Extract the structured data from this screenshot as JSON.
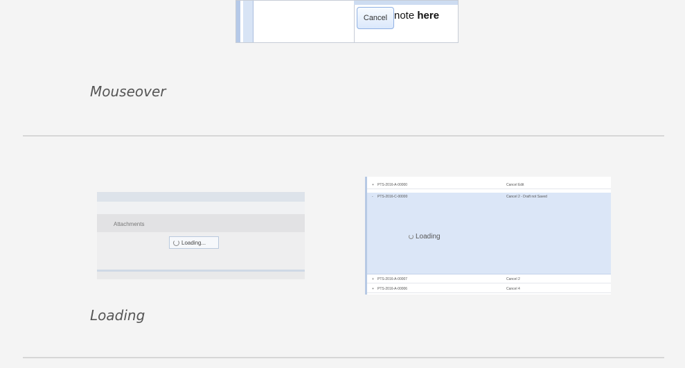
{
  "mouseover": {
    "cancel_label": "Cancel",
    "note_prefix": "note ",
    "note_bold": "here",
    "caption": "Mouseover"
  },
  "loading": {
    "caption": "Loading",
    "panel": {
      "attachments_label": "Attachments",
      "loading_text": "Loading..."
    },
    "grid": {
      "loading_text": "Loading",
      "rows": [
        {
          "id": "PTS-2016-A-00000",
          "desc": "Cancel Edit"
        },
        {
          "id": "PTS-2016-C-00000",
          "desc": "Cancel 2 - Draft not Saved"
        },
        {
          "id": "PTS-2016-A-00007",
          "desc": "Cancel 2"
        },
        {
          "id": "PTS-2016-A-00006",
          "desc": "Cancel 4"
        }
      ]
    }
  }
}
